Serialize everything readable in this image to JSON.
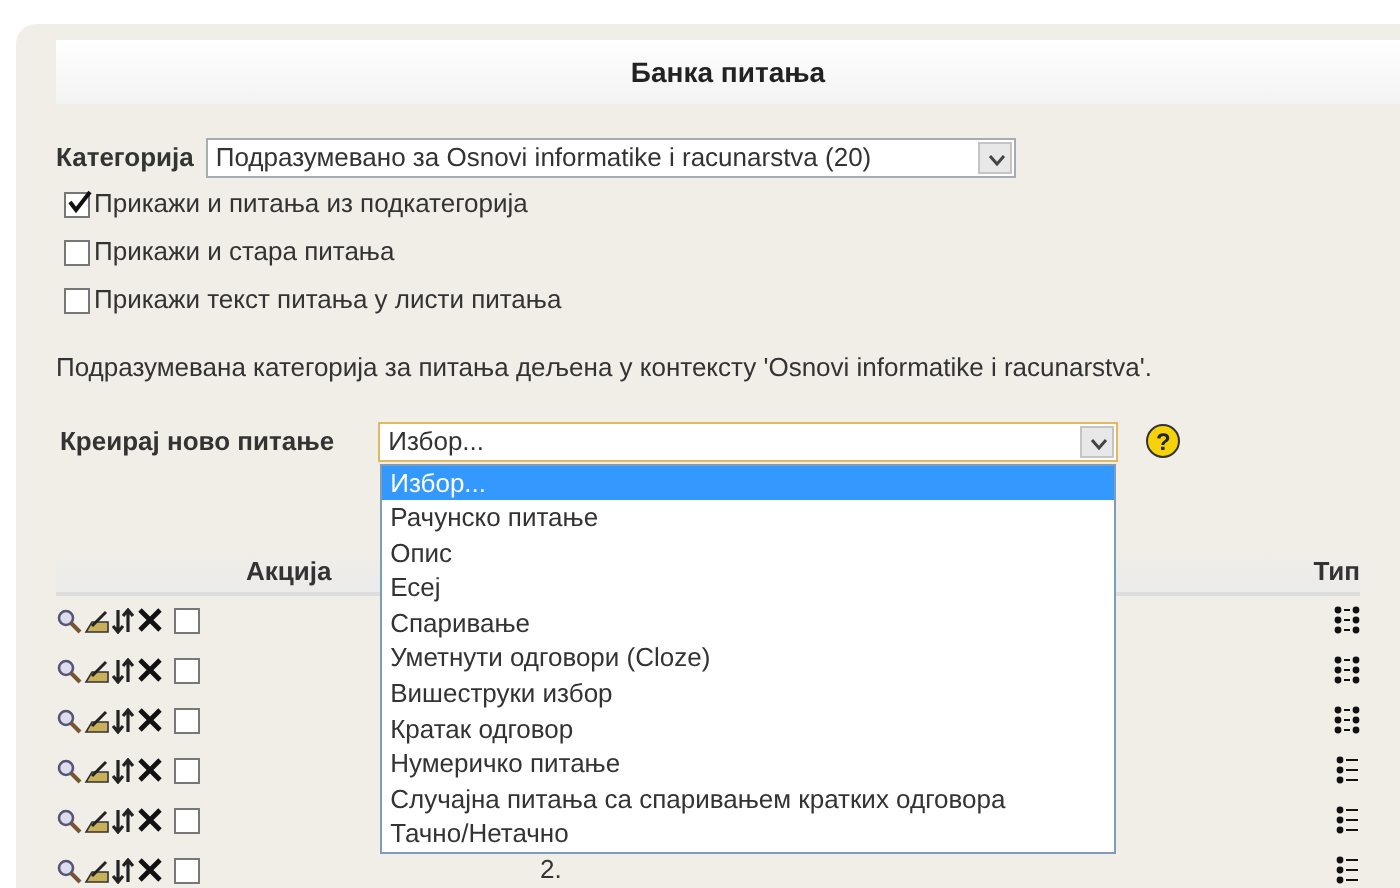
{
  "title": "Банка питања",
  "category": {
    "label": "Категорија",
    "value": "Подразумевано за Osnovi informatike i racunarstva (20)"
  },
  "options": [
    {
      "label": "Прикажи и питања из подкатегорија",
      "checked": true
    },
    {
      "label": "Прикажи и стара питања",
      "checked": false
    },
    {
      "label": "Прикажи текст питања у листи питања",
      "checked": false
    }
  ],
  "info": "Подразумевана категорија за питања дељена у контексту 'Osnovi informatike i racunarstva'.",
  "create": {
    "label": "Креирај ново питање",
    "value": "Избор...",
    "expanded": true,
    "help": "?",
    "items": [
      {
        "label": "Избор...",
        "selected": true
      },
      {
        "label": "Рачунско питање",
        "selected": false
      },
      {
        "label": "Опис",
        "selected": false
      },
      {
        "label": "Есеј",
        "selected": false
      },
      {
        "label": "Спаривање",
        "selected": false
      },
      {
        "label": "Уметнути одговори (Cloze)",
        "selected": false
      },
      {
        "label": "Вишеструки избор",
        "selected": false
      },
      {
        "label": "Кратак одговор",
        "selected": false
      },
      {
        "label": "Нумеричко питање",
        "selected": false
      },
      {
        "label": "Случајна питања са спаривањем кратких одговора",
        "selected": false
      },
      {
        "label": "Тачно/Нетачно",
        "selected": false
      }
    ]
  },
  "table": {
    "columns": [
      "Акција",
      "Тип"
    ],
    "rows": [
      {
        "checked": false,
        "kind": "double"
      },
      {
        "checked": false,
        "kind": "double"
      },
      {
        "checked": false,
        "kind": "double"
      },
      {
        "checked": false,
        "kind": "single"
      },
      {
        "checked": false,
        "kind": "single"
      },
      {
        "checked": false,
        "kind": "single",
        "number": "2."
      }
    ]
  }
}
